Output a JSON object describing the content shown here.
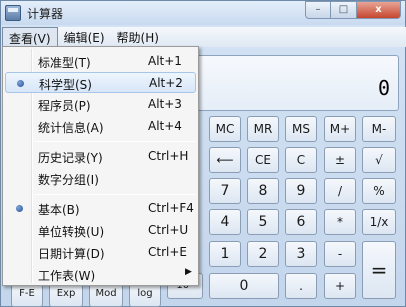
{
  "window": {
    "title": "计算器",
    "controls": {
      "minimize": "–",
      "maximize": "□",
      "close": "x"
    }
  },
  "menubar": {
    "items": [
      {
        "label": "查看(V)"
      },
      {
        "label": "编辑(E)"
      },
      {
        "label": "帮助(H)"
      }
    ]
  },
  "view_menu": {
    "items": [
      {
        "label": "标准型(T)",
        "shortcut": "Alt+1"
      },
      {
        "label": "科学型(S)",
        "shortcut": "Alt+2",
        "selected": true
      },
      {
        "label": "程序员(P)",
        "shortcut": "Alt+3"
      },
      {
        "label": "统计信息(A)",
        "shortcut": "Alt+4"
      },
      {
        "label": "历史记录(Y)",
        "shortcut": "Ctrl+H"
      },
      {
        "label": "数字分组(I)",
        "shortcut": ""
      },
      {
        "label": "基本(B)",
        "shortcut": "Ctrl+F4",
        "selected": true
      },
      {
        "label": "单位转换(U)",
        "shortcut": "Ctrl+U"
      },
      {
        "label": "日期计算(D)",
        "shortcut": "Ctrl+E"
      },
      {
        "label": "工作表(W)",
        "shortcut": "",
        "submenu": true
      }
    ]
  },
  "display": {
    "value": "0"
  },
  "keys": {
    "mc": "MC",
    "mr": "MR",
    "ms": "MS",
    "mplus": "M+",
    "mminus": "M-",
    "backspace": "⟵",
    "ce": "CE",
    "c": "C",
    "plusminus": "±",
    "sqrt": "√",
    "seven": "7",
    "eight": "8",
    "nine": "9",
    "divide": "/",
    "percent": "%",
    "four": "4",
    "five": "5",
    "six": "6",
    "multiply": "*",
    "reciprocal": "1/x",
    "one": "1",
    "two": "2",
    "three": "3",
    "minus": "-",
    "equals": "=",
    "zero": "0",
    "decimal": ".",
    "plus": "+",
    "fe": "F-E",
    "exp": "Exp",
    "mod": "Mod",
    "log": "log",
    "ten_pow": "10ˣ"
  }
}
